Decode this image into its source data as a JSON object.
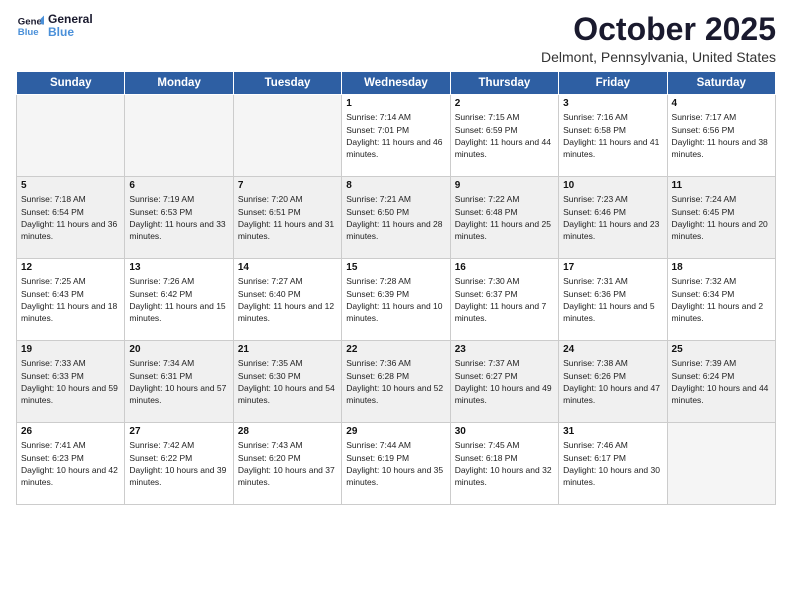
{
  "header": {
    "logo_line1": "General",
    "logo_line2": "Blue",
    "month": "October 2025",
    "location": "Delmont, Pennsylvania, United States"
  },
  "days_of_week": [
    "Sunday",
    "Monday",
    "Tuesday",
    "Wednesday",
    "Thursday",
    "Friday",
    "Saturday"
  ],
  "weeks": [
    [
      {
        "day": "",
        "empty": true
      },
      {
        "day": "",
        "empty": true
      },
      {
        "day": "",
        "empty": true
      },
      {
        "day": "1",
        "sunrise": "7:14 AM",
        "sunset": "7:01 PM",
        "daylight": "11 hours and 46 minutes."
      },
      {
        "day": "2",
        "sunrise": "7:15 AM",
        "sunset": "6:59 PM",
        "daylight": "11 hours and 44 minutes."
      },
      {
        "day": "3",
        "sunrise": "7:16 AM",
        "sunset": "6:58 PM",
        "daylight": "11 hours and 41 minutes."
      },
      {
        "day": "4",
        "sunrise": "7:17 AM",
        "sunset": "6:56 PM",
        "daylight": "11 hours and 38 minutes."
      }
    ],
    [
      {
        "day": "5",
        "sunrise": "7:18 AM",
        "sunset": "6:54 PM",
        "daylight": "11 hours and 36 minutes."
      },
      {
        "day": "6",
        "sunrise": "7:19 AM",
        "sunset": "6:53 PM",
        "daylight": "11 hours and 33 minutes."
      },
      {
        "day": "7",
        "sunrise": "7:20 AM",
        "sunset": "6:51 PM",
        "daylight": "11 hours and 31 minutes."
      },
      {
        "day": "8",
        "sunrise": "7:21 AM",
        "sunset": "6:50 PM",
        "daylight": "11 hours and 28 minutes."
      },
      {
        "day": "9",
        "sunrise": "7:22 AM",
        "sunset": "6:48 PM",
        "daylight": "11 hours and 25 minutes."
      },
      {
        "day": "10",
        "sunrise": "7:23 AM",
        "sunset": "6:46 PM",
        "daylight": "11 hours and 23 minutes."
      },
      {
        "day": "11",
        "sunrise": "7:24 AM",
        "sunset": "6:45 PM",
        "daylight": "11 hours and 20 minutes."
      }
    ],
    [
      {
        "day": "12",
        "sunrise": "7:25 AM",
        "sunset": "6:43 PM",
        "daylight": "11 hours and 18 minutes."
      },
      {
        "day": "13",
        "sunrise": "7:26 AM",
        "sunset": "6:42 PM",
        "daylight": "11 hours and 15 minutes."
      },
      {
        "day": "14",
        "sunrise": "7:27 AM",
        "sunset": "6:40 PM",
        "daylight": "11 hours and 12 minutes."
      },
      {
        "day": "15",
        "sunrise": "7:28 AM",
        "sunset": "6:39 PM",
        "daylight": "11 hours and 10 minutes."
      },
      {
        "day": "16",
        "sunrise": "7:30 AM",
        "sunset": "6:37 PM",
        "daylight": "11 hours and 7 minutes."
      },
      {
        "day": "17",
        "sunrise": "7:31 AM",
        "sunset": "6:36 PM",
        "daylight": "11 hours and 5 minutes."
      },
      {
        "day": "18",
        "sunrise": "7:32 AM",
        "sunset": "6:34 PM",
        "daylight": "11 hours and 2 minutes."
      }
    ],
    [
      {
        "day": "19",
        "sunrise": "7:33 AM",
        "sunset": "6:33 PM",
        "daylight": "10 hours and 59 minutes."
      },
      {
        "day": "20",
        "sunrise": "7:34 AM",
        "sunset": "6:31 PM",
        "daylight": "10 hours and 57 minutes."
      },
      {
        "day": "21",
        "sunrise": "7:35 AM",
        "sunset": "6:30 PM",
        "daylight": "10 hours and 54 minutes."
      },
      {
        "day": "22",
        "sunrise": "7:36 AM",
        "sunset": "6:28 PM",
        "daylight": "10 hours and 52 minutes."
      },
      {
        "day": "23",
        "sunrise": "7:37 AM",
        "sunset": "6:27 PM",
        "daylight": "10 hours and 49 minutes."
      },
      {
        "day": "24",
        "sunrise": "7:38 AM",
        "sunset": "6:26 PM",
        "daylight": "10 hours and 47 minutes."
      },
      {
        "day": "25",
        "sunrise": "7:39 AM",
        "sunset": "6:24 PM",
        "daylight": "10 hours and 44 minutes."
      }
    ],
    [
      {
        "day": "26",
        "sunrise": "7:41 AM",
        "sunset": "6:23 PM",
        "daylight": "10 hours and 42 minutes."
      },
      {
        "day": "27",
        "sunrise": "7:42 AM",
        "sunset": "6:22 PM",
        "daylight": "10 hours and 39 minutes."
      },
      {
        "day": "28",
        "sunrise": "7:43 AM",
        "sunset": "6:20 PM",
        "daylight": "10 hours and 37 minutes."
      },
      {
        "day": "29",
        "sunrise": "7:44 AM",
        "sunset": "6:19 PM",
        "daylight": "10 hours and 35 minutes."
      },
      {
        "day": "30",
        "sunrise": "7:45 AM",
        "sunset": "6:18 PM",
        "daylight": "10 hours and 32 minutes."
      },
      {
        "day": "31",
        "sunrise": "7:46 AM",
        "sunset": "6:17 PM",
        "daylight": "10 hours and 30 minutes."
      },
      {
        "day": "",
        "empty": true
      }
    ]
  ]
}
